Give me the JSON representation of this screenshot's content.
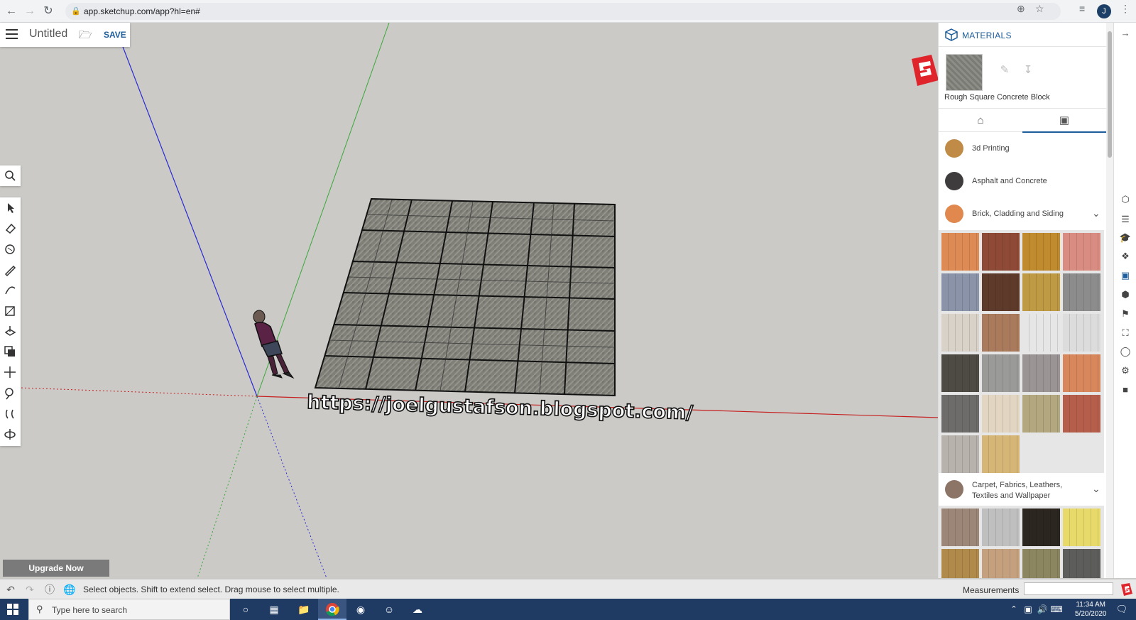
{
  "browser": {
    "url": "app.sketchup.com/app?hl=en#"
  },
  "app": {
    "title": "Untitled",
    "save_label": "SAVE",
    "upgrade_label": "Upgrade Now",
    "watermark": "https://joelgustafson.blogspot.com/"
  },
  "panel": {
    "title": "MATERIALS",
    "current_material": "Rough Square Concrete Block",
    "categories": [
      {
        "label": "3d Printing",
        "color": "#c08a47"
      },
      {
        "label": "Asphalt and Concrete",
        "color": "#3f3c3d"
      },
      {
        "label": "Brick, Cladding and Siding",
        "color": "#e1884e"
      },
      {
        "label": "Carpet, Fabrics, Leathers, Textiles and Wallpaper",
        "color": "#8c7566"
      }
    ],
    "brick_swatches": [
      "#dd8a55",
      "#8e4a36",
      "#c08a2e",
      "#d98c82",
      "#8a93a8",
      "#5d3a2a",
      "#bf9a45",
      "#8c8c8c",
      "#d8d2c8",
      "#a97a5c",
      "#e6e6e6",
      "#dcdcdc",
      "#4e4b44",
      "#9a9a98",
      "#9b9494",
      "#d7875b",
      "#6e6c6a",
      "#e2d6c2",
      "#b3a780",
      "#b55e4b",
      "#b7b2ab",
      "#d6b676"
    ],
    "carpet_swatches": [
      "#9b8677",
      "#bfbfbf",
      "#2c2620",
      "#e8da6a",
      "#b08a4a",
      "#c4a07e",
      "#8c8660",
      "#5d5d5b"
    ]
  },
  "status": {
    "hint": "Select objects. Shift to extend select. Drag mouse to select multiple.",
    "measurements_label": "Measurements"
  },
  "taskbar": {
    "search_placeholder": "Type here to search",
    "time": "11:34 AM",
    "date": "5/20/2020"
  }
}
